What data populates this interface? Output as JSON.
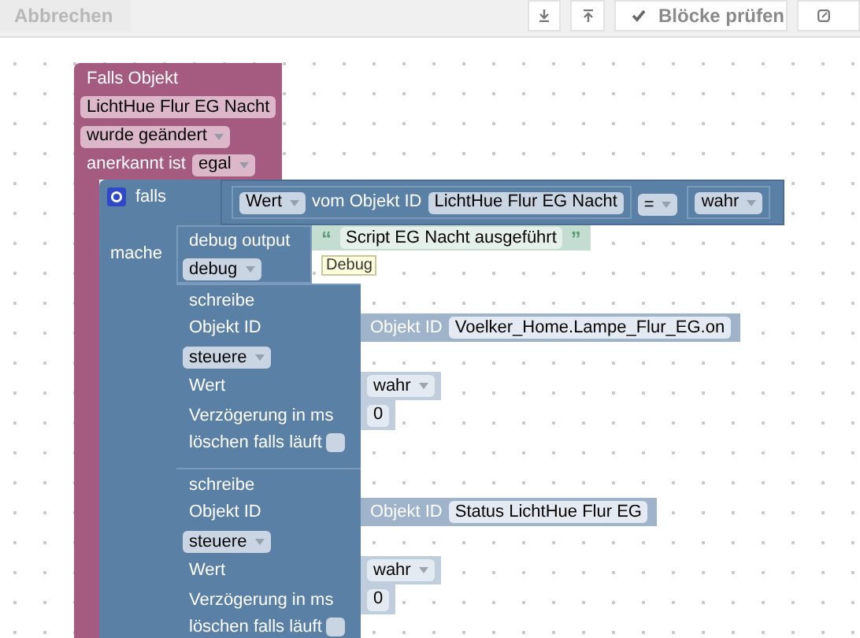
{
  "toolbar": {
    "cancel": "Abbrechen",
    "check": "Blöcke prüfen"
  },
  "trigger_block": {
    "title": "Falls Objekt",
    "object": "LichtHue Flur EG Nacht",
    "event": "wurde geändert",
    "ack_label": "anerkannt ist",
    "ack": "egal"
  },
  "if_block": {
    "if_label": "falls",
    "do_label": "mache",
    "condition": {
      "value_field": "Wert",
      "from_label": "vom Objekt ID",
      "object": "LichtHue Flur EG Nacht",
      "operator": "=",
      "compare": "wahr"
    }
  },
  "debug_block": {
    "label": "debug output",
    "log_level": "debug",
    "open_quote": "“",
    "text": "Script EG Nacht ausgeführt",
    "close_quote": "”",
    "tooltip": "Debug"
  },
  "write_blocks": [
    {
      "title": "schreibe",
      "object_label": "Objekt ID",
      "id_label": "Objekt ID",
      "object": "Voelker_Home.Lampe_Flur_EG.on",
      "mode": "steuere",
      "value_label": "Wert",
      "value": "wahr",
      "delay_label": "Verzögerung in ms",
      "delay": "0",
      "clear_label": "löschen falls läuft",
      "clear_running": false
    },
    {
      "title": "schreibe",
      "object_label": "Objekt ID",
      "id_label": "Objekt ID",
      "object": "Status LichtHue Flur EG",
      "mode": "steuere",
      "value_label": "Wert",
      "value": "wahr",
      "delay_label": "Verzögerung in ms",
      "delay": "0",
      "clear_label": "löschen falls läuft",
      "clear_running": false
    }
  ]
}
